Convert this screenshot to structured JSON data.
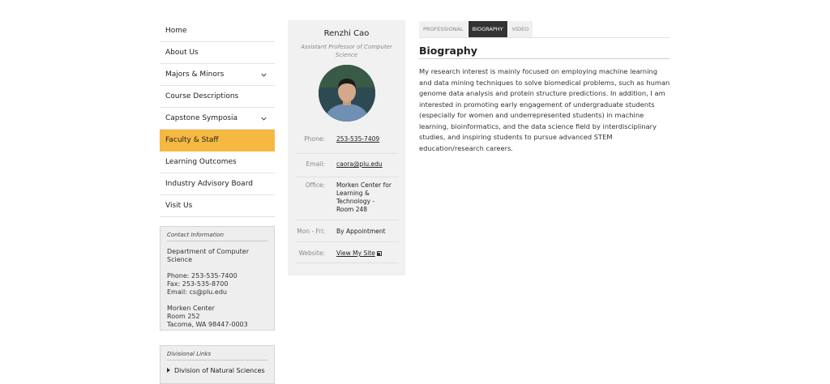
{
  "nav": {
    "items": [
      {
        "label": "Home"
      },
      {
        "label": "About Us"
      },
      {
        "label": "Majors & Minors"
      },
      {
        "label": "Course Descriptions"
      },
      {
        "label": "Capstone Symposia"
      },
      {
        "label": "Faculty & Staff"
      },
      {
        "label": "Learning Outcomes"
      },
      {
        "label": "Industry Advisory Board"
      },
      {
        "label": "Visit Us"
      }
    ],
    "active_color": "#f5b942"
  },
  "contact": {
    "title": "Contact Information",
    "department": "Department of Computer Science",
    "phone_label": "Phone: ",
    "phone": "253-535-7400",
    "fax": "Fax: 253-535-8700",
    "email_label": "Email: ",
    "email": "cs@plu.edu",
    "address1": "Morken Center",
    "address2": "Room 252",
    "address3": "Tacoma, WA 98447-0003"
  },
  "divisional_links": {
    "title": "Divisional Links",
    "item": "Division of Natural Sciences"
  },
  "profile": {
    "name": "Renzhi Cao",
    "title": "Assistant Professor of Computer Science",
    "phone_label": "Phone:",
    "phone": "253-535-7409",
    "email_label": "Email:",
    "email": "caora@plu.edu",
    "office_label": "Office:",
    "office": "Morken Center for Learning & Technology - Room 248",
    "hours_label": "Mon - Fri:",
    "hours": "By Appointment",
    "website_label": "Website:",
    "website": "View My Site"
  },
  "tabs": [
    {
      "label": "PROFESSIONAL"
    },
    {
      "label": "BIOGRAPHY"
    },
    {
      "label": "VIDEO"
    }
  ],
  "biography": {
    "heading": "Biography",
    "text": "My research interest is mainly focused on employing machine learning and data mining techniques to solve biomedical problems, such as human genome data analysis and protein structure predictions. In addition, I am interested in promoting early engagement of undergraduate students (especially for women and underrepresented students) in machine learning, bioinformatics, and the data science field by interdisciplinary studies, and inspiring students to pursue advanced STEM education/research careers."
  }
}
